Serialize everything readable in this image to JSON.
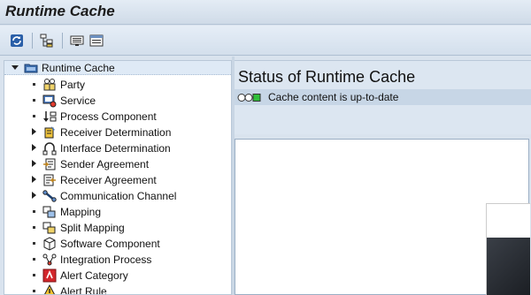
{
  "window": {
    "title": "Runtime Cache"
  },
  "toolbar": {
    "buttons": [
      {
        "name": "refresh-icon"
      },
      {
        "name": "hierarchy-icon"
      },
      {
        "name": "display-icon"
      },
      {
        "name": "list-icon"
      }
    ]
  },
  "tree": {
    "root": {
      "label": "Runtime Cache",
      "icon": "cache-folder-icon",
      "expanded": true
    },
    "items": [
      {
        "label": "Party",
        "icon": "party-icon",
        "expandable": false
      },
      {
        "label": "Service",
        "icon": "service-icon",
        "expandable": false
      },
      {
        "label": "Process Component",
        "icon": "process-component-icon",
        "expandable": false
      },
      {
        "label": "Receiver Determination",
        "icon": "receiver-determination-icon",
        "expandable": true
      },
      {
        "label": "Interface Determination",
        "icon": "interface-determination-icon",
        "expandable": true
      },
      {
        "label": "Sender Agreement",
        "icon": "sender-agreement-icon",
        "expandable": true
      },
      {
        "label": "Receiver Agreement",
        "icon": "receiver-agreement-icon",
        "expandable": true
      },
      {
        "label": "Communication Channel",
        "icon": "communication-channel-icon",
        "expandable": true
      },
      {
        "label": "Mapping",
        "icon": "mapping-icon",
        "expandable": false
      },
      {
        "label": "Split Mapping",
        "icon": "split-mapping-icon",
        "expandable": false
      },
      {
        "label": "Software Component",
        "icon": "software-component-icon",
        "expandable": false
      },
      {
        "label": "Integration Process",
        "icon": "integration-process-icon",
        "expandable": false
      },
      {
        "label": "Alert Category",
        "icon": "alert-category-icon",
        "expandable": false
      },
      {
        "label": "Alert Rule",
        "icon": "alert-rule-icon",
        "expandable": false
      }
    ]
  },
  "status": {
    "title": "Status of Runtime Cache",
    "message": "Cache content is up-to-date",
    "light": "green",
    "colors": {
      "green": "#2fbf3a",
      "off": "#ffffff"
    }
  }
}
